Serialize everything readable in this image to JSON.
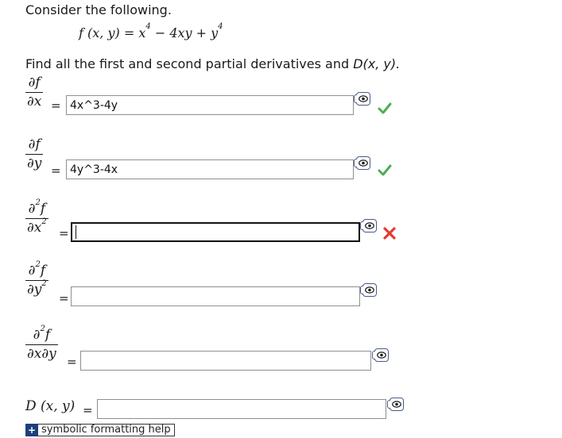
{
  "header": {
    "intro": "Consider the following.",
    "formula": {
      "lhs": "f (x, y)",
      "rhs_parts": [
        "x",
        "4",
        " − 4xy + y",
        "4"
      ]
    },
    "prompt_text": "Find all the first and second partial derivatives and ",
    "prompt_math": "D(x, y).",
    "prompt_end": "."
  },
  "rows": [
    {
      "id": "fx",
      "num": "∂f",
      "num_sup": "",
      "den": "∂x",
      "den_sup": "",
      "value": "4x^3-4y",
      "status": "correct"
    },
    {
      "id": "fy",
      "num": "∂f",
      "num_sup": "",
      "den": "∂y",
      "den_sup": "",
      "value": "4y^3-4x",
      "status": "correct"
    },
    {
      "id": "fxx",
      "num": "∂",
      "num_sup": "2",
      "den": "∂x",
      "den_sup": "2",
      "value": "",
      "status": "incorrect"
    },
    {
      "id": "fyy",
      "num": "∂",
      "num_sup": "2",
      "den": "∂y",
      "den_sup": "2",
      "value": "",
      "status": "none"
    },
    {
      "id": "fxy",
      "num": "∂",
      "num_sup": "2",
      "den": "∂x∂y",
      "den_sup": "",
      "value": "",
      "status": "none"
    }
  ],
  "d_row": {
    "label": "D (x, y)",
    "value": ""
  },
  "eq_sign": "=",
  "help": {
    "badge": "+",
    "label": "symbolic formatting help"
  },
  "icons": {
    "preview": "eye-preview-icon",
    "correct": "check-icon",
    "incorrect": "x-icon"
  },
  "colors": {
    "correct": "#4caf50",
    "incorrect": "#e53935",
    "icon_border": "#4a5a8a",
    "help_badge": "#1e3f7a"
  }
}
